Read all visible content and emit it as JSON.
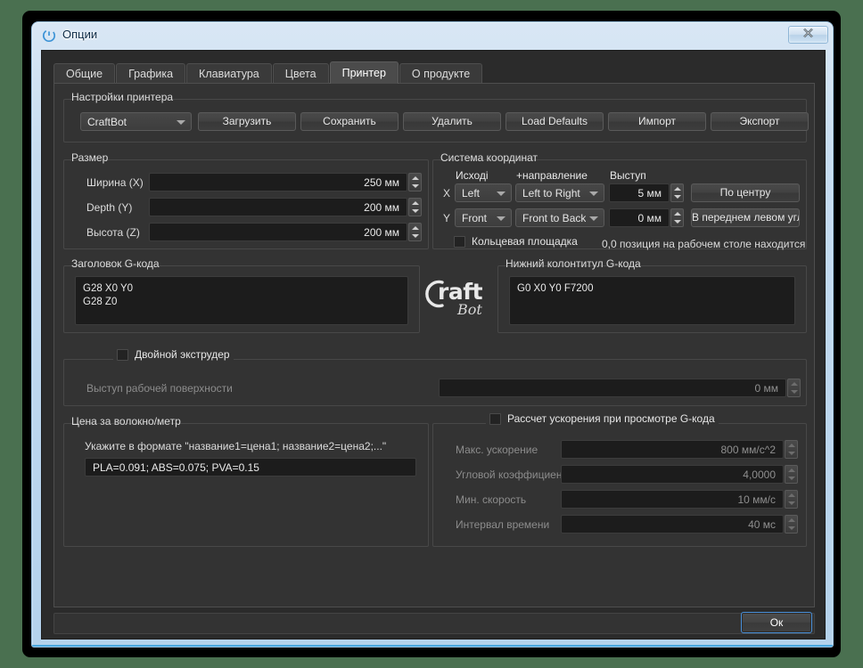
{
  "window": {
    "title": "Опции",
    "icon": "app-logo-icon",
    "close_label": "✕",
    "accent": "#4aa8e0",
    "frame_color": "#bcd6ee",
    "client_bg": "#2b2b2b"
  },
  "tabs": [
    {
      "label": "Общие",
      "active": false
    },
    {
      "label": "Графика",
      "active": false
    },
    {
      "label": "Клавиатура",
      "active": false
    },
    {
      "label": "Цвета",
      "active": false
    },
    {
      "label": "Принтер",
      "active": true
    },
    {
      "label": "О продукте",
      "active": false
    }
  ],
  "printer_settings": {
    "group_label": "Настройки принтера",
    "profile_combo": {
      "value": "CraftBot",
      "arrow": "chevron-down-icon"
    },
    "buttons": [
      {
        "label": "Загрузить"
      },
      {
        "label": "Сохранить"
      },
      {
        "label": "Удалить"
      },
      {
        "label": "Load Defaults"
      },
      {
        "label": "Импорт"
      },
      {
        "label": "Экспорт"
      }
    ]
  },
  "size": {
    "group_label": "Размер",
    "rows": [
      {
        "label": "Ширина (X)",
        "value": "250 мм"
      },
      {
        "label": "Depth (Y)",
        "value": "200 мм"
      },
      {
        "label": "Высота (Z)",
        "value": "200 мм"
      }
    ]
  },
  "coords": {
    "group_label": "Система координат",
    "col_origin": "Исході",
    "col_direction": "+направление",
    "col_offset": "Выступ",
    "axis_x": {
      "axis": "X",
      "origin": "Left",
      "direction": "Left to Right",
      "offset": "5 мм",
      "button": "По центру"
    },
    "axis_y": {
      "axis": "Y",
      "origin": "Front",
      "direction": "Front to Back",
      "offset": "0 мм",
      "button": "В переднем левом углу"
    },
    "circular_checkbox": {
      "label": "Кольцевая площадка",
      "checked": false
    },
    "note": "0,0 позиция на рабочем столе находится"
  },
  "gcode_header": {
    "group_label": "Заголовок G-кода",
    "text": "G28 X0 Y0\nG28 Z0"
  },
  "gcode_footer": {
    "group_label": "Нижний колонтитул G-кода",
    "text": "G0 X0 Y0 F7200"
  },
  "logo": {
    "name": "craftbot-logo",
    "line1": "Craft",
    "line2": "Bot"
  },
  "dual_extruder": {
    "checkbox": {
      "label": "Двойной экструдер",
      "checked": false
    },
    "offset_label": "Выступ рабочей поверхности",
    "offset_value": "0 мм",
    "disabled": true
  },
  "filament_price": {
    "group_label": "Цена за волокно/метр",
    "hint": "Укажите в формате \"название1=цена1; название2=цена2;...\"",
    "value": "PLA=0.091; ABS=0.075; PVA=0.15"
  },
  "acceleration": {
    "checkbox": {
      "label": "Рассчет ускорения при просмотре G-кода",
      "checked": false
    },
    "disabled": true,
    "rows": [
      {
        "label": "Макс. ускорение",
        "value": "800 мм/с^2"
      },
      {
        "label": "Угловой коэффициент",
        "value": "4,0000"
      },
      {
        "label": "Мин. скорость",
        "value": "10 мм/с"
      },
      {
        "label": "Интервал времени",
        "value": "40 мс"
      }
    ]
  },
  "footer": {
    "ok_label": "Ок"
  }
}
